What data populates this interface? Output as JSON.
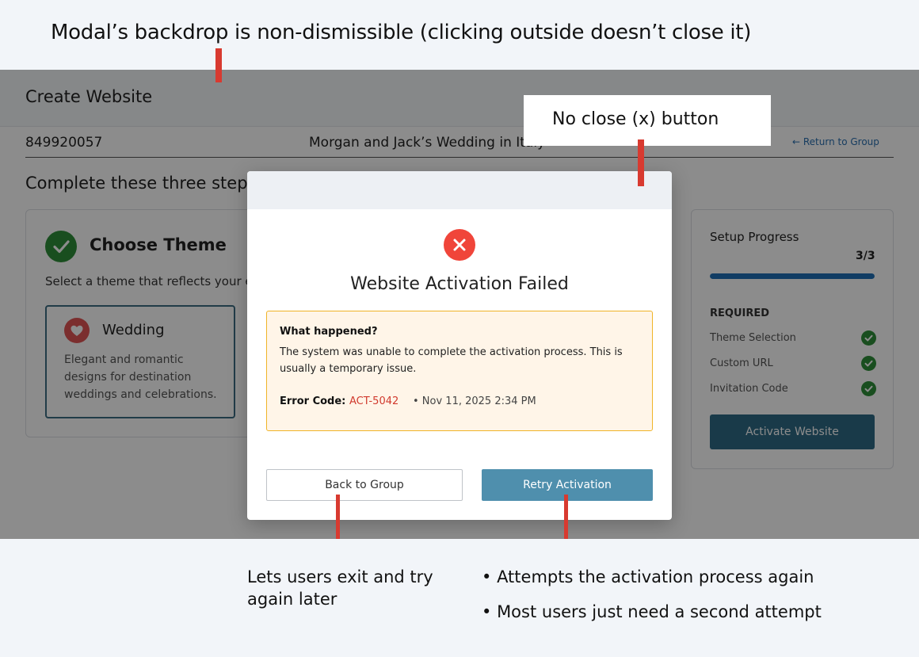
{
  "annotations": {
    "top": "Modal’s backdrop is non-dismissible (clicking outside doesn’t close it)",
    "close_callout": "No close (x) button",
    "back_note": "Lets users exit and try again later",
    "retry_notes": [
      "Attempts the activation process again",
      "Most users just need a second attempt"
    ]
  },
  "app": {
    "title": "Create Website",
    "group_id": "849920057",
    "group_name": "Morgan and Jack’s Wedding in Italy",
    "return_link": "← Return to Group",
    "steps_heading": "Complete these three steps",
    "theme_step": {
      "title": "Choose Theme",
      "description": "Select a theme that reflects your event",
      "selected_theme": {
        "name": "Wedding",
        "description": "Elegant and romantic designs for destination weddings and celebrations."
      }
    },
    "progress": {
      "title": "Setup Progress",
      "count": "3/3",
      "fraction": 1.0,
      "required_label": "REQUIRED",
      "items": [
        {
          "label": "Theme Selection",
          "done": true
        },
        {
          "label": "Custom URL",
          "done": true
        },
        {
          "label": "Invitation Code",
          "done": true
        }
      ],
      "activate_label": "Activate Website"
    }
  },
  "modal": {
    "title": "Website Activation Failed",
    "info_heading": "What happened?",
    "info_text": "The system was unable to complete the activation process. This is usually a temporary issue.",
    "error_code_label": "Error Code:",
    "error_code": "ACT-5042",
    "timestamp": "• Nov 11, 2025 2:34 PM",
    "back_label": "Back to Group",
    "retry_label": "Retry Activation"
  },
  "colors": {
    "error": "#f0453a",
    "success": "#2f8f3a",
    "primary": "#2e6b86",
    "retry": "#4f8fad",
    "warning_border": "#f0b429",
    "marker": "#d83a30"
  },
  "icons": [
    "check-icon",
    "heart-icon",
    "error-x-icon",
    "arrow-left-icon"
  ]
}
